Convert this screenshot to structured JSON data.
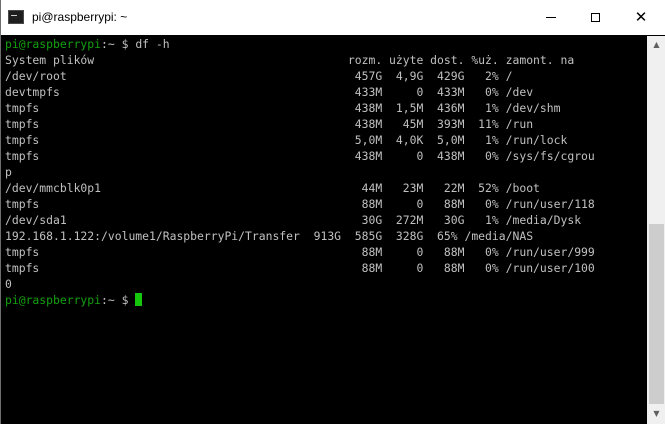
{
  "window": {
    "title": "pi@raspberrypi: ~"
  },
  "prompt": {
    "user_host": "pi@raspberrypi",
    "path": ":~ $ ",
    "command": "df -h"
  },
  "output_lines": [
    "System plików                                     rozm. użyte dost. %uż. zamont. na",
    "/dev/root                                          457G  4,9G  429G   2% /",
    "devtmpfs                                           433M     0  433M   0% /dev",
    "tmpfs                                              438M  1,5M  436M   1% /dev/shm",
    "tmpfs                                              438M   45M  393M  11% /run",
    "tmpfs                                              5,0M  4,0K  5,0M   1% /run/lock",
    "tmpfs                                              438M     0  438M   0% /sys/fs/cgrou",
    "p",
    "/dev/mmcblk0p1                                      44M   23M   22M  52% /boot",
    "tmpfs                                               88M     0   88M   0% /run/user/118",
    "/dev/sda1                                           30G  272M   30G   1% /media/Dysk",
    "192.168.1.122:/volume1/RaspberryPi/Transfer  913G  585G  328G  65% /media/NAS",
    "tmpfs                                               88M     0   88M   0% /run/user/999",
    "tmpfs                                               88M     0   88M   0% /run/user/100",
    "0"
  ],
  "final_prompt": {
    "user_host": "pi@raspberrypi",
    "path": ":~ $ "
  },
  "controls": {
    "minimize": "—",
    "maximize": "□",
    "close": "✕"
  },
  "scroll": {
    "up": "▲",
    "down": "▼"
  }
}
